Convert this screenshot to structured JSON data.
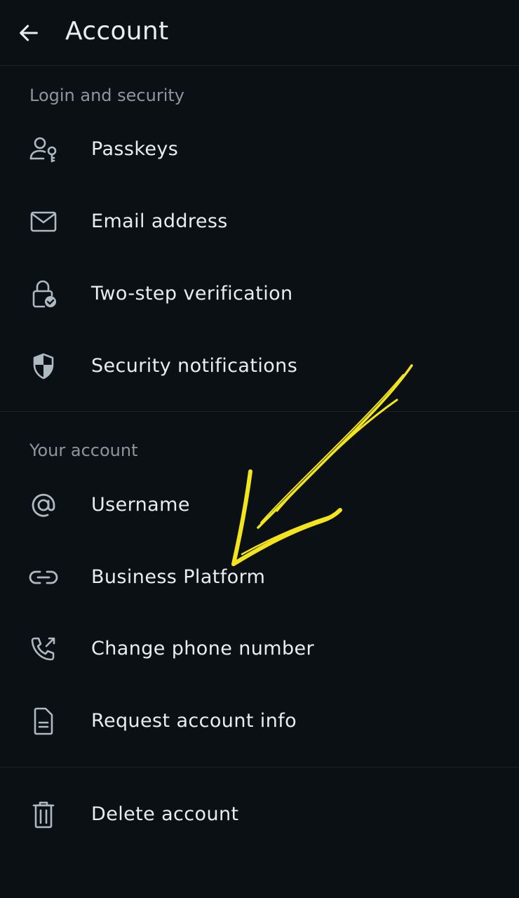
{
  "header": {
    "title": "Account",
    "back_icon": "arrow-left-icon"
  },
  "sections": [
    {
      "label": "Login and security",
      "items": [
        {
          "label": "Passkeys",
          "icon": "person-key-icon"
        },
        {
          "label": "Email address",
          "icon": "mail-icon"
        },
        {
          "label": "Two-step verification",
          "icon": "lock-check-icon"
        },
        {
          "label": "Security notifications",
          "icon": "shield-icon"
        }
      ]
    },
    {
      "label": "Your account",
      "items": [
        {
          "label": "Username",
          "icon": "at-sign-icon"
        },
        {
          "label": "Business Platform",
          "icon": "link-icon"
        },
        {
          "label": "Change phone number",
          "icon": "phone-arrow-icon"
        },
        {
          "label": "Request account info",
          "icon": "document-icon"
        }
      ]
    },
    {
      "items": [
        {
          "label": "Delete account",
          "icon": "trash-icon"
        }
      ]
    }
  ],
  "colors": {
    "background": "#0b1014",
    "text": "#e9edef",
    "secondary_text": "#8e969b",
    "icon": "#aebac1",
    "divider": "#1c2327",
    "annotation": "#f2e51d"
  }
}
